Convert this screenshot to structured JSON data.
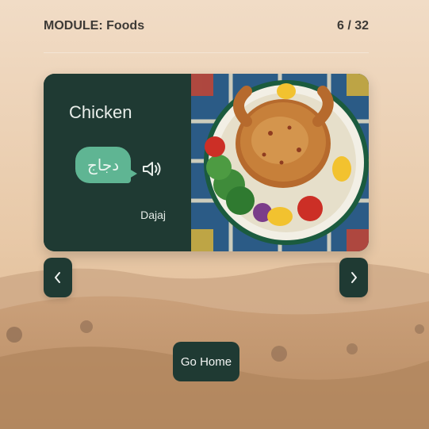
{
  "header": {
    "module_label": "MODULE: Foods",
    "progress_text": "6 / 32"
  },
  "card": {
    "english_word": "Chicken",
    "arabic_word": "دجاج",
    "transliteration": "Dajaj",
    "image_icon": "roast-chicken-plate"
  },
  "nav": {
    "prev_icon": "chevron-left-icon",
    "next_icon": "chevron-right-icon"
  },
  "footer": {
    "home_label": "Go Home"
  },
  "colors": {
    "card_bg": "#1f3a33",
    "bubble_bg": "#5fb593",
    "background_sand": "#d8b28a"
  }
}
